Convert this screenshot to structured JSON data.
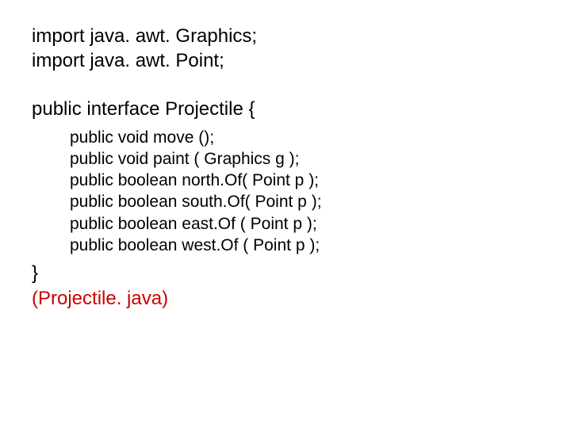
{
  "imports": {
    "graphics": "import java. awt. Graphics;",
    "point": "import java. awt. Point;"
  },
  "interface_decl": "public interface Projectile {",
  "methods": {
    "move": "public void move ();",
    "paint": "public void paint ( Graphics g );",
    "northOf": "public boolean north.Of( Point p );",
    "southOf": "public boolean south.Of( Point p );",
    "eastOf": "public boolean east.Of ( Point p );",
    "westOf": "public boolean west.Of ( Point p );"
  },
  "close_brace": "}",
  "filename": "(Projectile. java)"
}
